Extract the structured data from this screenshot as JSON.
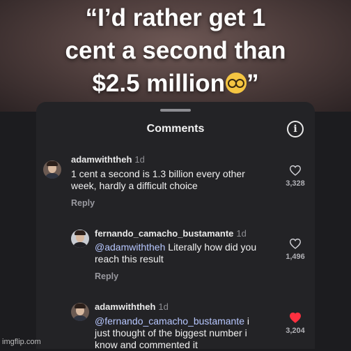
{
  "video_caption": {
    "line1": "“I’d rather get 1",
    "line2": "cent a second than",
    "line3": "$2.5 million",
    "close_quote": "”"
  },
  "sheet": {
    "title": "Comments",
    "info_icon": "info-icon"
  },
  "comments": [
    {
      "username": "adamwiththeh",
      "time": "1d",
      "mention": "",
      "text_line1": "1 cent a second is 1.3 billion every other",
      "text_line2": "week, hardly a difficult choice",
      "reply_label": "Reply",
      "likes": "3,328",
      "liked": false
    },
    {
      "username": "fernando_camacho_bustamante",
      "time": "1d",
      "mention": "@adamwiththeh",
      "text_line1": " Literally how did you",
      "text_line2": "reach this result",
      "reply_label": "Reply",
      "likes": "1,496",
      "liked": false
    },
    {
      "username": "adamwiththeh",
      "time": "1d",
      "mention": "@fernando_camacho_bustamante",
      "text_line1": " i",
      "text_line2": "just thought of the biggest number i",
      "text_line3": "know and commented it",
      "likes": "3,204",
      "liked": true
    }
  ],
  "colors": {
    "heart_liked": "#ff3040",
    "heart_outline": "#d0d0d5",
    "mention": "#b7c7ff"
  },
  "watermark": "imgflip.com"
}
